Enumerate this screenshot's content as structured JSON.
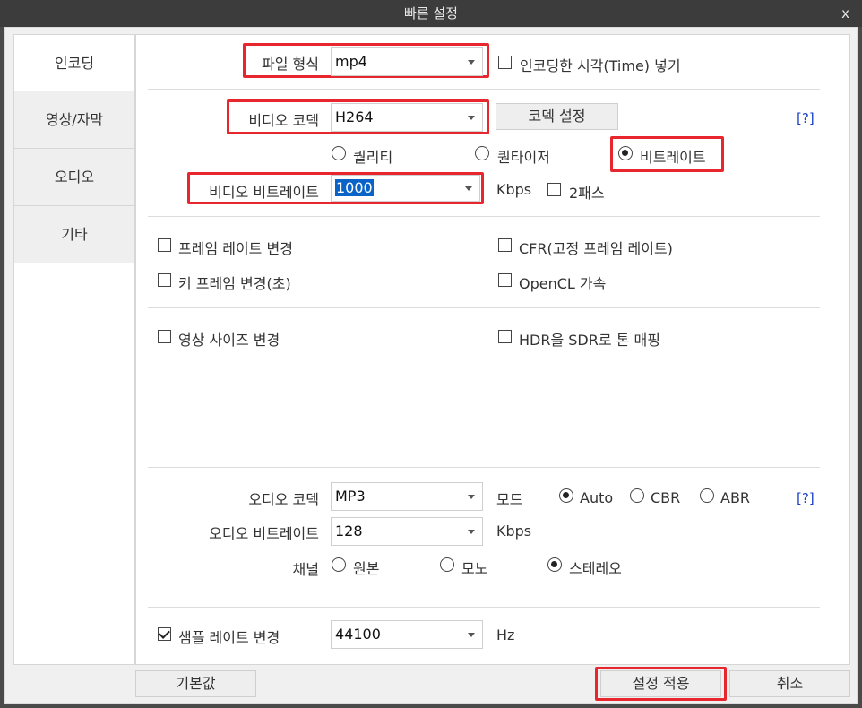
{
  "window": {
    "title": "빠른 설정",
    "close": "x"
  },
  "sidebar": {
    "tabs": [
      {
        "label": "인코딩"
      },
      {
        "label": "영상/자막"
      },
      {
        "label": "오디오"
      },
      {
        "label": "기타"
      }
    ]
  },
  "encoding": {
    "file_format_label": "파일 형식",
    "file_format_value": "mp4",
    "insert_time_label": "인코딩한 시각(Time) 넣기"
  },
  "video": {
    "codec_label": "비디오 코덱",
    "codec_value": "H264",
    "codec_settings_button": "코덱 설정",
    "help": "[?]",
    "mode_quality": "퀄리티",
    "mode_quantizer": "퀀타이저",
    "mode_bitrate": "비트레이트",
    "bitrate_label": "비디오 비트레이트",
    "bitrate_value": "1000",
    "bitrate_unit": "Kbps",
    "two_pass": "2패스",
    "change_framerate": "프레임 레이트 변경",
    "cfr": "CFR(고정 프레임 레이트)",
    "change_keyframe": "키 프레임 변경(초)",
    "opencl": "OpenCL 가속",
    "change_size": "영상 사이즈 변경",
    "hdr_to_sdr": "HDR을 SDR로 톤 매핑"
  },
  "audio": {
    "codec_label": "오디오 코덱",
    "codec_value": "MP3",
    "mode_label": "모드",
    "mode_auto": "Auto",
    "mode_cbr": "CBR",
    "mode_abr": "ABR",
    "help": "[?]",
    "bitrate_label": "오디오 비트레이트",
    "bitrate_value": "128",
    "bitrate_unit": "Kbps",
    "channel_label": "채널",
    "channel_original": "원본",
    "channel_mono": "모노",
    "channel_stereo": "스테레오",
    "change_samplerate": "샘플 레이트 변경",
    "samplerate_value": "44100",
    "samplerate_unit": "Hz"
  },
  "footer": {
    "default_button": "기본값",
    "apply_button": "설정 적용",
    "cancel_button": "취소"
  },
  "colors": {
    "highlight": "#e8262e",
    "selection": "#0a64c8",
    "help_link": "#1a3fc8",
    "titlebar": "#3c3c3c"
  }
}
